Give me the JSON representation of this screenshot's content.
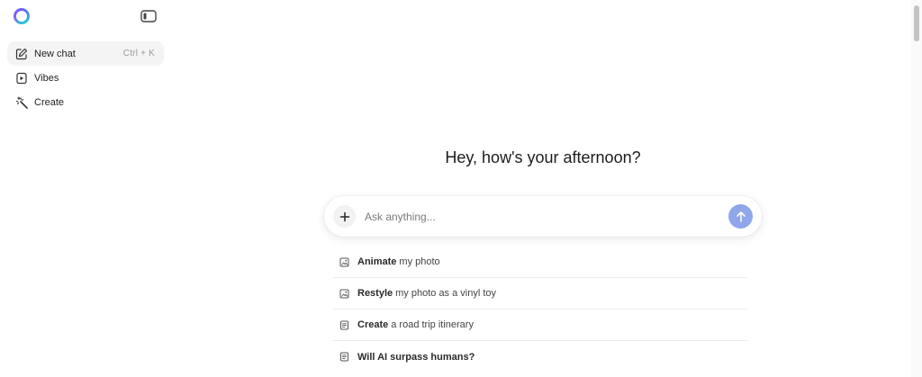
{
  "sidebar": {
    "items": [
      {
        "label": "New chat",
        "shortcut": "Ctrl + K",
        "icon": "edit-icon",
        "active": true
      },
      {
        "label": "Vibes",
        "icon": "play-square-icon"
      },
      {
        "label": "Create",
        "icon": "magic-wand-icon"
      }
    ]
  },
  "main": {
    "greeting": "Hey, how's your afternoon?",
    "composer": {
      "placeholder": "Ask anything..."
    },
    "suggestions": [
      {
        "bold": "Animate",
        "rest": "my photo",
        "icon": "image-icon"
      },
      {
        "bold": "Restyle",
        "rest": "my photo as a vinyl toy",
        "icon": "image-icon"
      },
      {
        "bold": "Create",
        "rest": "a road trip itinerary",
        "icon": "document-icon"
      },
      {
        "bold": "Will AI surpass humans?",
        "rest": "",
        "icon": "document-icon"
      }
    ]
  },
  "colors": {
    "send_button": "#8fa6ea",
    "accent": "#6b5cf5"
  }
}
